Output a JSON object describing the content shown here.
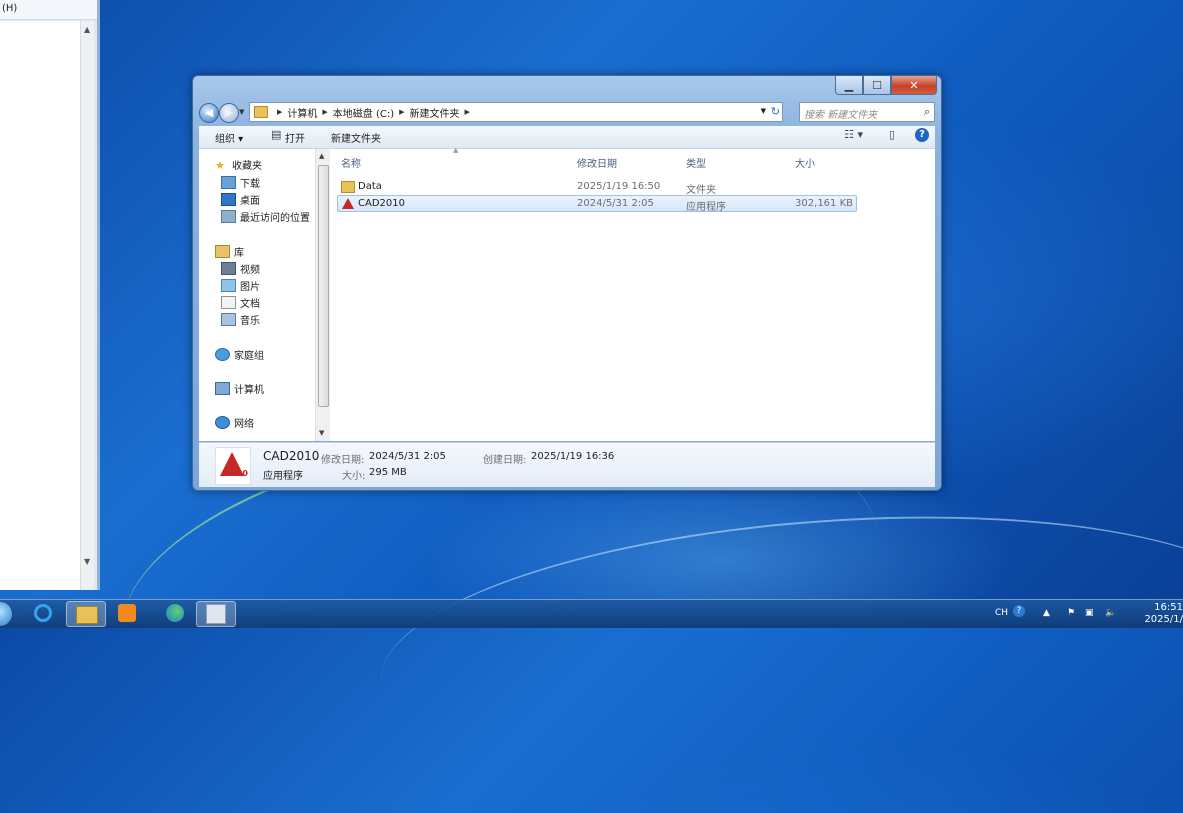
{
  "background_window": {
    "menu_text": "(H)"
  },
  "window": {
    "caption": {
      "minimize": "▁",
      "maximize": "☐",
      "close": "✕"
    },
    "address": {
      "crumbs": [
        "计算机",
        "本地磁盘 (C:)",
        "新建文件夹"
      ],
      "search_placeholder": "搜索 新建文件夹"
    },
    "toolbar": {
      "organize": "组织 ▾",
      "open": "打开",
      "new_folder": "新建文件夹"
    },
    "nav": {
      "favorites": "收藏夹",
      "downloads": "下载",
      "desktop": "桌面",
      "recent": "最近访问的位置",
      "libraries": "库",
      "videos": "视频",
      "pictures": "图片",
      "documents": "文档",
      "music": "音乐",
      "homegroup": "家庭组",
      "computer": "计算机",
      "network": "网络"
    },
    "columns": {
      "name": "名称",
      "modified": "修改日期",
      "type": "类型",
      "size": "大小"
    },
    "files": [
      {
        "name": "Data",
        "modified": "2025/1/19 16:50",
        "type": "文件夹",
        "size": ""
      },
      {
        "name": "CAD2010",
        "modified": "2024/5/31 2:05",
        "type": "应用程序",
        "size": "302,161 KB"
      }
    ],
    "details": {
      "name": "CAD2010",
      "type": "应用程序",
      "modified_label": "修改日期:",
      "modified_value": "2024/5/31 2:05",
      "created_label": "创建日期:",
      "created_value": "2025/1/19 16:36",
      "size_label": "大小:",
      "size_value": "295 MB",
      "icon_badge": "2010"
    }
  },
  "taskbar": {
    "tray": {
      "lang": "CH",
      "help": "?"
    },
    "clock_time": "16:51",
    "clock_date": "2025/1/"
  }
}
